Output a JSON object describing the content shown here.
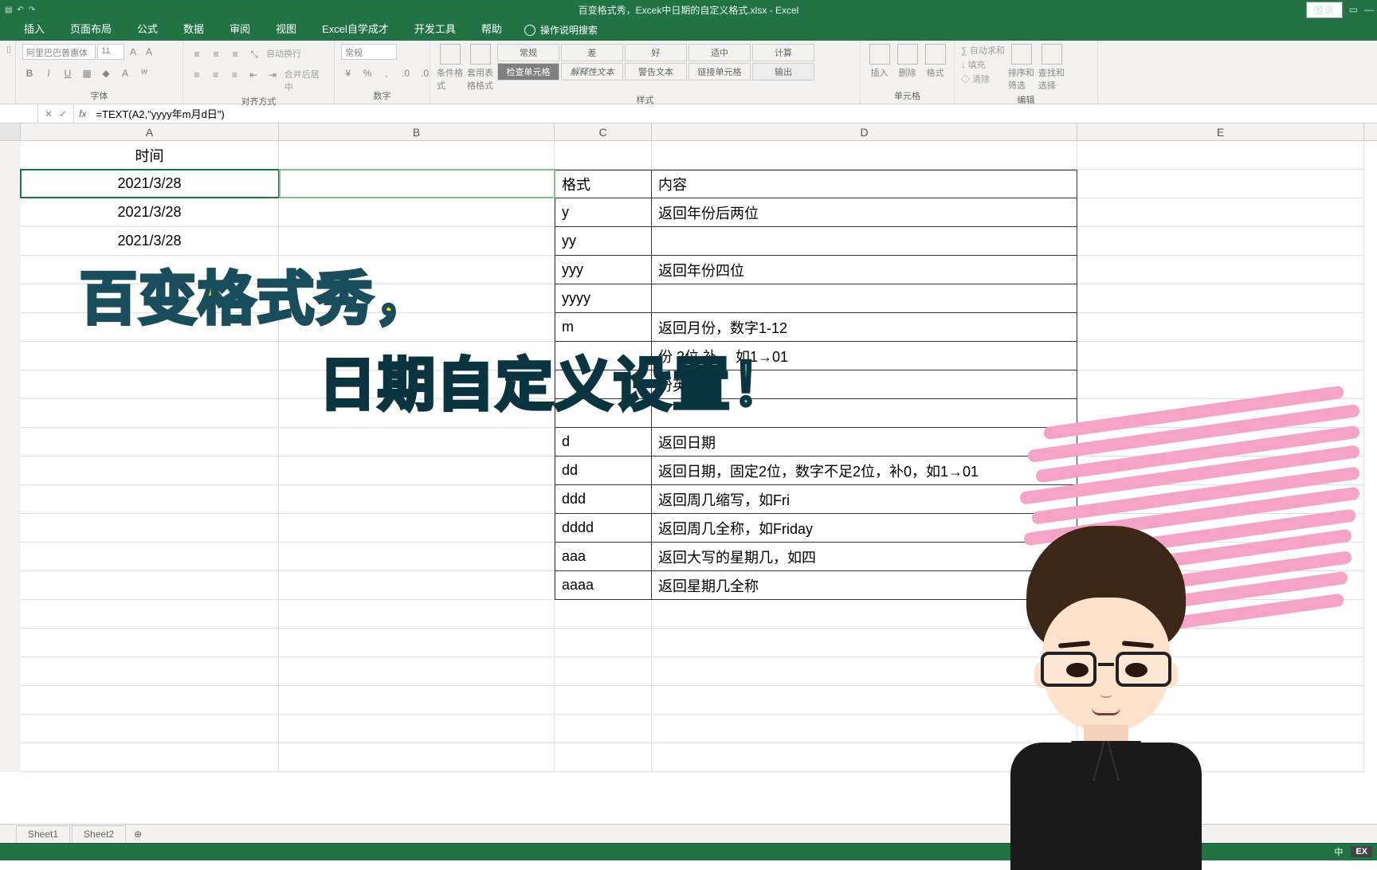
{
  "titlebar": {
    "title": "百变格式秀，Excek中日期的自定义格式.xlsx - Excel",
    "login": "登录"
  },
  "tabs": [
    "插入",
    "页面布局",
    "公式",
    "数据",
    "审阅",
    "视图",
    "Excel自学成才",
    "开发工具",
    "帮助"
  ],
  "tellme": "操作说明搜索",
  "ribbon": {
    "font_name": "阿里巴巴普惠体",
    "font_size": "11",
    "group_font": "字体",
    "group_align": "对齐方式",
    "group_number": "数字",
    "group_styles": "样式",
    "group_cells": "单元格",
    "group_edit": "编辑",
    "wrap": "自动换行",
    "merge": "合并后居中",
    "num_format": "常规",
    "cond_fmt": "条件格式",
    "table_fmt": "套用表格格式",
    "styles": {
      "s1": "常规",
      "s2": "差",
      "s3": "好",
      "s4": "适中",
      "s5": "计算",
      "s6": "检查单元格",
      "s7": "解释性文本",
      "s8": "警告文本",
      "s9": "链接单元格",
      "s10": "输出"
    },
    "insert": "插入",
    "delete": "删除",
    "format": "格式",
    "autosum": "自动求和",
    "fill": "填充",
    "clear": "清除",
    "sort": "排序和筛选",
    "find": "查找和选择"
  },
  "formula_bar": {
    "formula": "=TEXT(A2,\"yyyy年m月d日\")"
  },
  "columns": [
    "A",
    "B",
    "C",
    "D",
    "E"
  ],
  "cells": {
    "A1": "时间",
    "A2": "2021/3/28",
    "A3": "2021/3/28",
    "A4": "2021/3/28"
  },
  "table": {
    "header_c": "格式",
    "header_d": "内容",
    "rows": [
      {
        "c": "y",
        "d": "返回年份后两位",
        "merge_next": true
      },
      {
        "c": "yy",
        "d": ""
      },
      {
        "c": "yyy",
        "d": "返回年份四位",
        "merge_next": true
      },
      {
        "c": "yyyy",
        "d": ""
      },
      {
        "c": "m",
        "d": "返回月份，数字1-12"
      },
      {
        "c": "",
        "d": "份    2位              补 ，如1→01"
      },
      {
        "c": "",
        "d": "份英    缩写"
      },
      {
        "c": "",
        "d": ""
      },
      {
        "c": "d",
        "d": "返回日期"
      },
      {
        "c": "dd",
        "d": "返回日期，固定2位，数字不足2位，补0，如1→01"
      },
      {
        "c": "ddd",
        "d": "返回周几缩写，如Fri"
      },
      {
        "c": "dddd",
        "d": "返回周几全称，如Friday"
      },
      {
        "c": "aaa",
        "d": "返回大写的星期几，如四"
      },
      {
        "c": "aaaa",
        "d": "返回星期几全称"
      }
    ]
  },
  "overlay": {
    "line1": "百变格式秀，",
    "line2": "日期自定义设置！"
  },
  "sheets": {
    "s1": "Sheet1",
    "s2": "Sheet2"
  },
  "statusbar": {
    "lang": "中",
    "ex": "EX"
  }
}
